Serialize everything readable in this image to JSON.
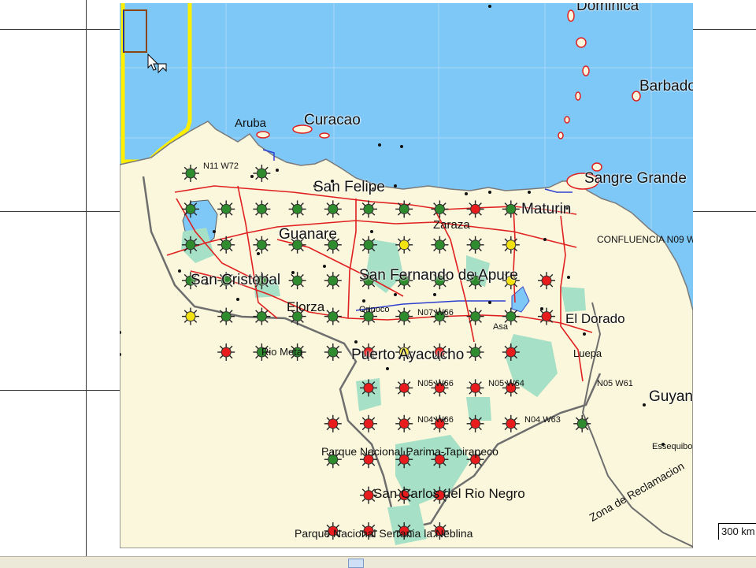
{
  "map": {
    "labels": {
      "dominica": "Dominica",
      "barbados": "Barbados",
      "aruba": "Aruba",
      "curacao": "Curacao",
      "sangre_grande": "Sangre Grande",
      "n11_w72": "N11 W72",
      "san_felipe": "San Felipe",
      "maturin": "Maturin",
      "zaraza": "Zaraza",
      "guanare": "Guanare",
      "confluencia": "CONFLUENCIA N09 W61",
      "san_cristobal": "San Cristobal",
      "san_fernando": "San Fernando de Apure",
      "elorza": "Elorza",
      "orinoco": "Orinoco",
      "n07_w66": "N07 W66",
      "asa": "Asa",
      "el_dorado": "El Dorado",
      "rio_meta": "Rio Meta",
      "puerto_ayacucho": "Puerto Ayacucho",
      "luepa": "Luepa",
      "n05_w66": "N05 W66",
      "n05_w64": "N05 W64",
      "n05_w61": "N05 W61",
      "guyana": "Guyana",
      "n04_w66": "N04 W66",
      "n04_w63": "N04 W63",
      "essequibo": "Essequibo",
      "parima": "Parque Nacional Parima-Tapirapeco",
      "san_carlos": "San Carlos del Rio Negro",
      "zona": "Zona de Reclamacion",
      "neblina": "Parque Nacional Serrania la Neblina"
    },
    "scale_label": "300 km",
    "status_colors": {
      "visited": "#2e8b2e",
      "partial": "#f2e20f",
      "unvisited": "#e81c1c"
    },
    "colors": {
      "sea": "#7ec8f8",
      "land": "#fbf7dc",
      "park": "#a6e0c6",
      "road": "#e02020",
      "border": "#6e6e6e",
      "river": "#3040d0",
      "highlight": "#ffee00"
    },
    "confluence_points": [
      {
        "lat": 11,
        "lon": -70,
        "status": "visited"
      },
      {
        "lat": 11,
        "lon": -72,
        "status": "visited"
      },
      {
        "lat": 10,
        "lon": -72,
        "status": "visited"
      },
      {
        "lat": 10,
        "lon": -71,
        "status": "visited"
      },
      {
        "lat": 10,
        "lon": -70,
        "status": "visited"
      },
      {
        "lat": 10,
        "lon": -69,
        "status": "visited"
      },
      {
        "lat": 10,
        "lon": -68,
        "status": "visited"
      },
      {
        "lat": 10,
        "lon": -67,
        "status": "visited"
      },
      {
        "lat": 10,
        "lon": -66,
        "status": "visited"
      },
      {
        "lat": 10,
        "lon": -65,
        "status": "visited"
      },
      {
        "lat": 10,
        "lon": -64,
        "status": "unvisited"
      },
      {
        "lat": 10,
        "lon": -63,
        "status": "visited"
      },
      {
        "lat": 9,
        "lon": -72,
        "status": "visited"
      },
      {
        "lat": 9,
        "lon": -71,
        "status": "visited"
      },
      {
        "lat": 9,
        "lon": -70,
        "status": "visited"
      },
      {
        "lat": 9,
        "lon": -69,
        "status": "visited"
      },
      {
        "lat": 9,
        "lon": -68,
        "status": "visited"
      },
      {
        "lat": 9,
        "lon": -67,
        "status": "visited"
      },
      {
        "lat": 9,
        "lon": -66,
        "status": "partial"
      },
      {
        "lat": 9,
        "lon": -65,
        "status": "visited"
      },
      {
        "lat": 9,
        "lon": -64,
        "status": "visited"
      },
      {
        "lat": 9,
        "lon": -63,
        "status": "partial"
      },
      {
        "lat": 8,
        "lon": -72,
        "status": "visited"
      },
      {
        "lat": 8,
        "lon": -71,
        "status": "visited"
      },
      {
        "lat": 8,
        "lon": -70,
        "status": "visited"
      },
      {
        "lat": 8,
        "lon": -69,
        "status": "visited"
      },
      {
        "lat": 8,
        "lon": -68,
        "status": "visited"
      },
      {
        "lat": 8,
        "lon": -67,
        "status": "visited"
      },
      {
        "lat": 8,
        "lon": -66,
        "status": "visited"
      },
      {
        "lat": 8,
        "lon": -65,
        "status": "visited"
      },
      {
        "lat": 8,
        "lon": -64,
        "status": "visited"
      },
      {
        "lat": 8,
        "lon": -63,
        "status": "partial"
      },
      {
        "lat": 8,
        "lon": -62,
        "status": "unvisited"
      },
      {
        "lat": 7,
        "lon": -72,
        "status": "partial"
      },
      {
        "lat": 7,
        "lon": -71,
        "status": "visited"
      },
      {
        "lat": 7,
        "lon": -70,
        "status": "visited"
      },
      {
        "lat": 7,
        "lon": -69,
        "status": "visited"
      },
      {
        "lat": 7,
        "lon": -68,
        "status": "visited"
      },
      {
        "lat": 7,
        "lon": -67,
        "status": "visited"
      },
      {
        "lat": 7,
        "lon": -66,
        "status": "visited"
      },
      {
        "lat": 7,
        "lon": -65,
        "status": "visited"
      },
      {
        "lat": 7,
        "lon": -64,
        "status": "visited"
      },
      {
        "lat": 7,
        "lon": -63,
        "status": "visited"
      },
      {
        "lat": 7,
        "lon": -62,
        "status": "unvisited"
      },
      {
        "lat": 6,
        "lon": -71,
        "status": "unvisited"
      },
      {
        "lat": 6,
        "lon": -70,
        "status": "visited"
      },
      {
        "lat": 6,
        "lon": -69,
        "status": "visited"
      },
      {
        "lat": 6,
        "lon": -68,
        "status": "visited"
      },
      {
        "lat": 6,
        "lon": -67,
        "status": "unvisited"
      },
      {
        "lat": 6,
        "lon": -66,
        "status": "partial"
      },
      {
        "lat": 6,
        "lon": -65,
        "status": "unvisited"
      },
      {
        "lat": 6,
        "lon": -64,
        "status": "visited"
      },
      {
        "lat": 6,
        "lon": -63,
        "status": "unvisited"
      },
      {
        "lat": 5,
        "lon": -67,
        "status": "unvisited"
      },
      {
        "lat": 5,
        "lon": -66,
        "status": "unvisited"
      },
      {
        "lat": 5,
        "lon": -65,
        "status": "unvisited"
      },
      {
        "lat": 5,
        "lon": -64,
        "status": "unvisited"
      },
      {
        "lat": 5,
        "lon": -63,
        "status": "unvisited"
      },
      {
        "lat": 4,
        "lon": -68,
        "status": "unvisited"
      },
      {
        "lat": 4,
        "lon": -67,
        "status": "unvisited"
      },
      {
        "lat": 4,
        "lon": -66,
        "status": "unvisited"
      },
      {
        "lat": 4,
        "lon": -65,
        "status": "unvisited"
      },
      {
        "lat": 4,
        "lon": -64,
        "status": "unvisited"
      },
      {
        "lat": 4,
        "lon": -63,
        "status": "unvisited"
      },
      {
        "lat": 4,
        "lon": -61,
        "status": "visited"
      },
      {
        "lat": 3,
        "lon": -68,
        "status": "visited"
      },
      {
        "lat": 3,
        "lon": -67,
        "status": "unvisited"
      },
      {
        "lat": 3,
        "lon": -66,
        "status": "unvisited"
      },
      {
        "lat": 3,
        "lon": -65,
        "status": "unvisited"
      },
      {
        "lat": 3,
        "lon": -64,
        "status": "unvisited"
      },
      {
        "lat": 2,
        "lon": -67,
        "status": "unvisited"
      },
      {
        "lat": 2,
        "lon": -66,
        "status": "unvisited"
      },
      {
        "lat": 2,
        "lon": -65,
        "status": "unvisited"
      },
      {
        "lat": 1,
        "lon": -68,
        "status": "unvisited"
      },
      {
        "lat": 1,
        "lon": -67,
        "status": "unvisited"
      },
      {
        "lat": 1,
        "lon": -66,
        "status": "unvisited"
      },
      {
        "lat": 1,
        "lon": -65,
        "status": "unvisited"
      },
      {
        "lat": 0,
        "lon": -66,
        "status": "unvisited"
      }
    ]
  }
}
